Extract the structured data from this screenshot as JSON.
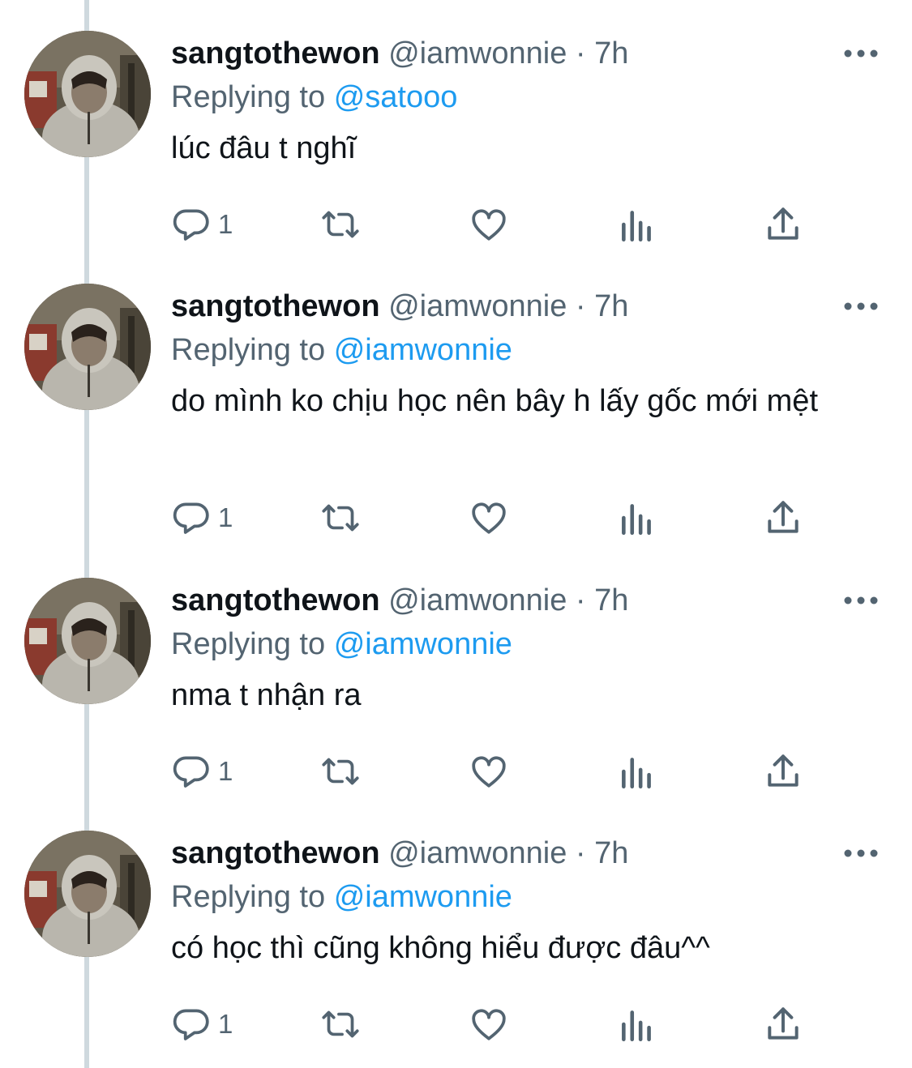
{
  "tweets": [
    {
      "name": "sangtothewon",
      "handle": "@iamwonnie",
      "separator": "·",
      "time": "7h",
      "replying_prefix": "Replying to",
      "replying_to": "@satooo",
      "text": "lúc đâu t nghĩ",
      "reply_count": "1"
    },
    {
      "name": "sangtothewon",
      "handle": "@iamwonnie",
      "separator": "·",
      "time": "7h",
      "replying_prefix": "Replying to",
      "replying_to": "@iamwonnie",
      "text": "do mình ko chịu học nên bây h lấy gốc mới mệt",
      "reply_count": "1"
    },
    {
      "name": "sangtothewon",
      "handle": "@iamwonnie",
      "separator": "·",
      "time": "7h",
      "replying_prefix": "Replying to",
      "replying_to": "@iamwonnie",
      "text": "nma t nhận ra",
      "reply_count": "1"
    },
    {
      "name": "sangtothewon",
      "handle": "@iamwonnie",
      "separator": "·",
      "time": "7h",
      "replying_prefix": "Replying to",
      "replying_to": "@iamwonnie",
      "text": "có học thì cũng không hiểu được đâu^^",
      "reply_count": "1"
    }
  ],
  "icons": {
    "more": "more-horizontal-icon",
    "reply": "reply-icon",
    "retweet": "retweet-icon",
    "like": "heart-icon",
    "analytics": "analytics-icon",
    "share": "share-icon"
  },
  "colors": {
    "text": "#0f1419",
    "secondary": "#536471",
    "link": "#1d9bf0",
    "thread_line": "#cfd9de",
    "background": "#ffffff"
  }
}
